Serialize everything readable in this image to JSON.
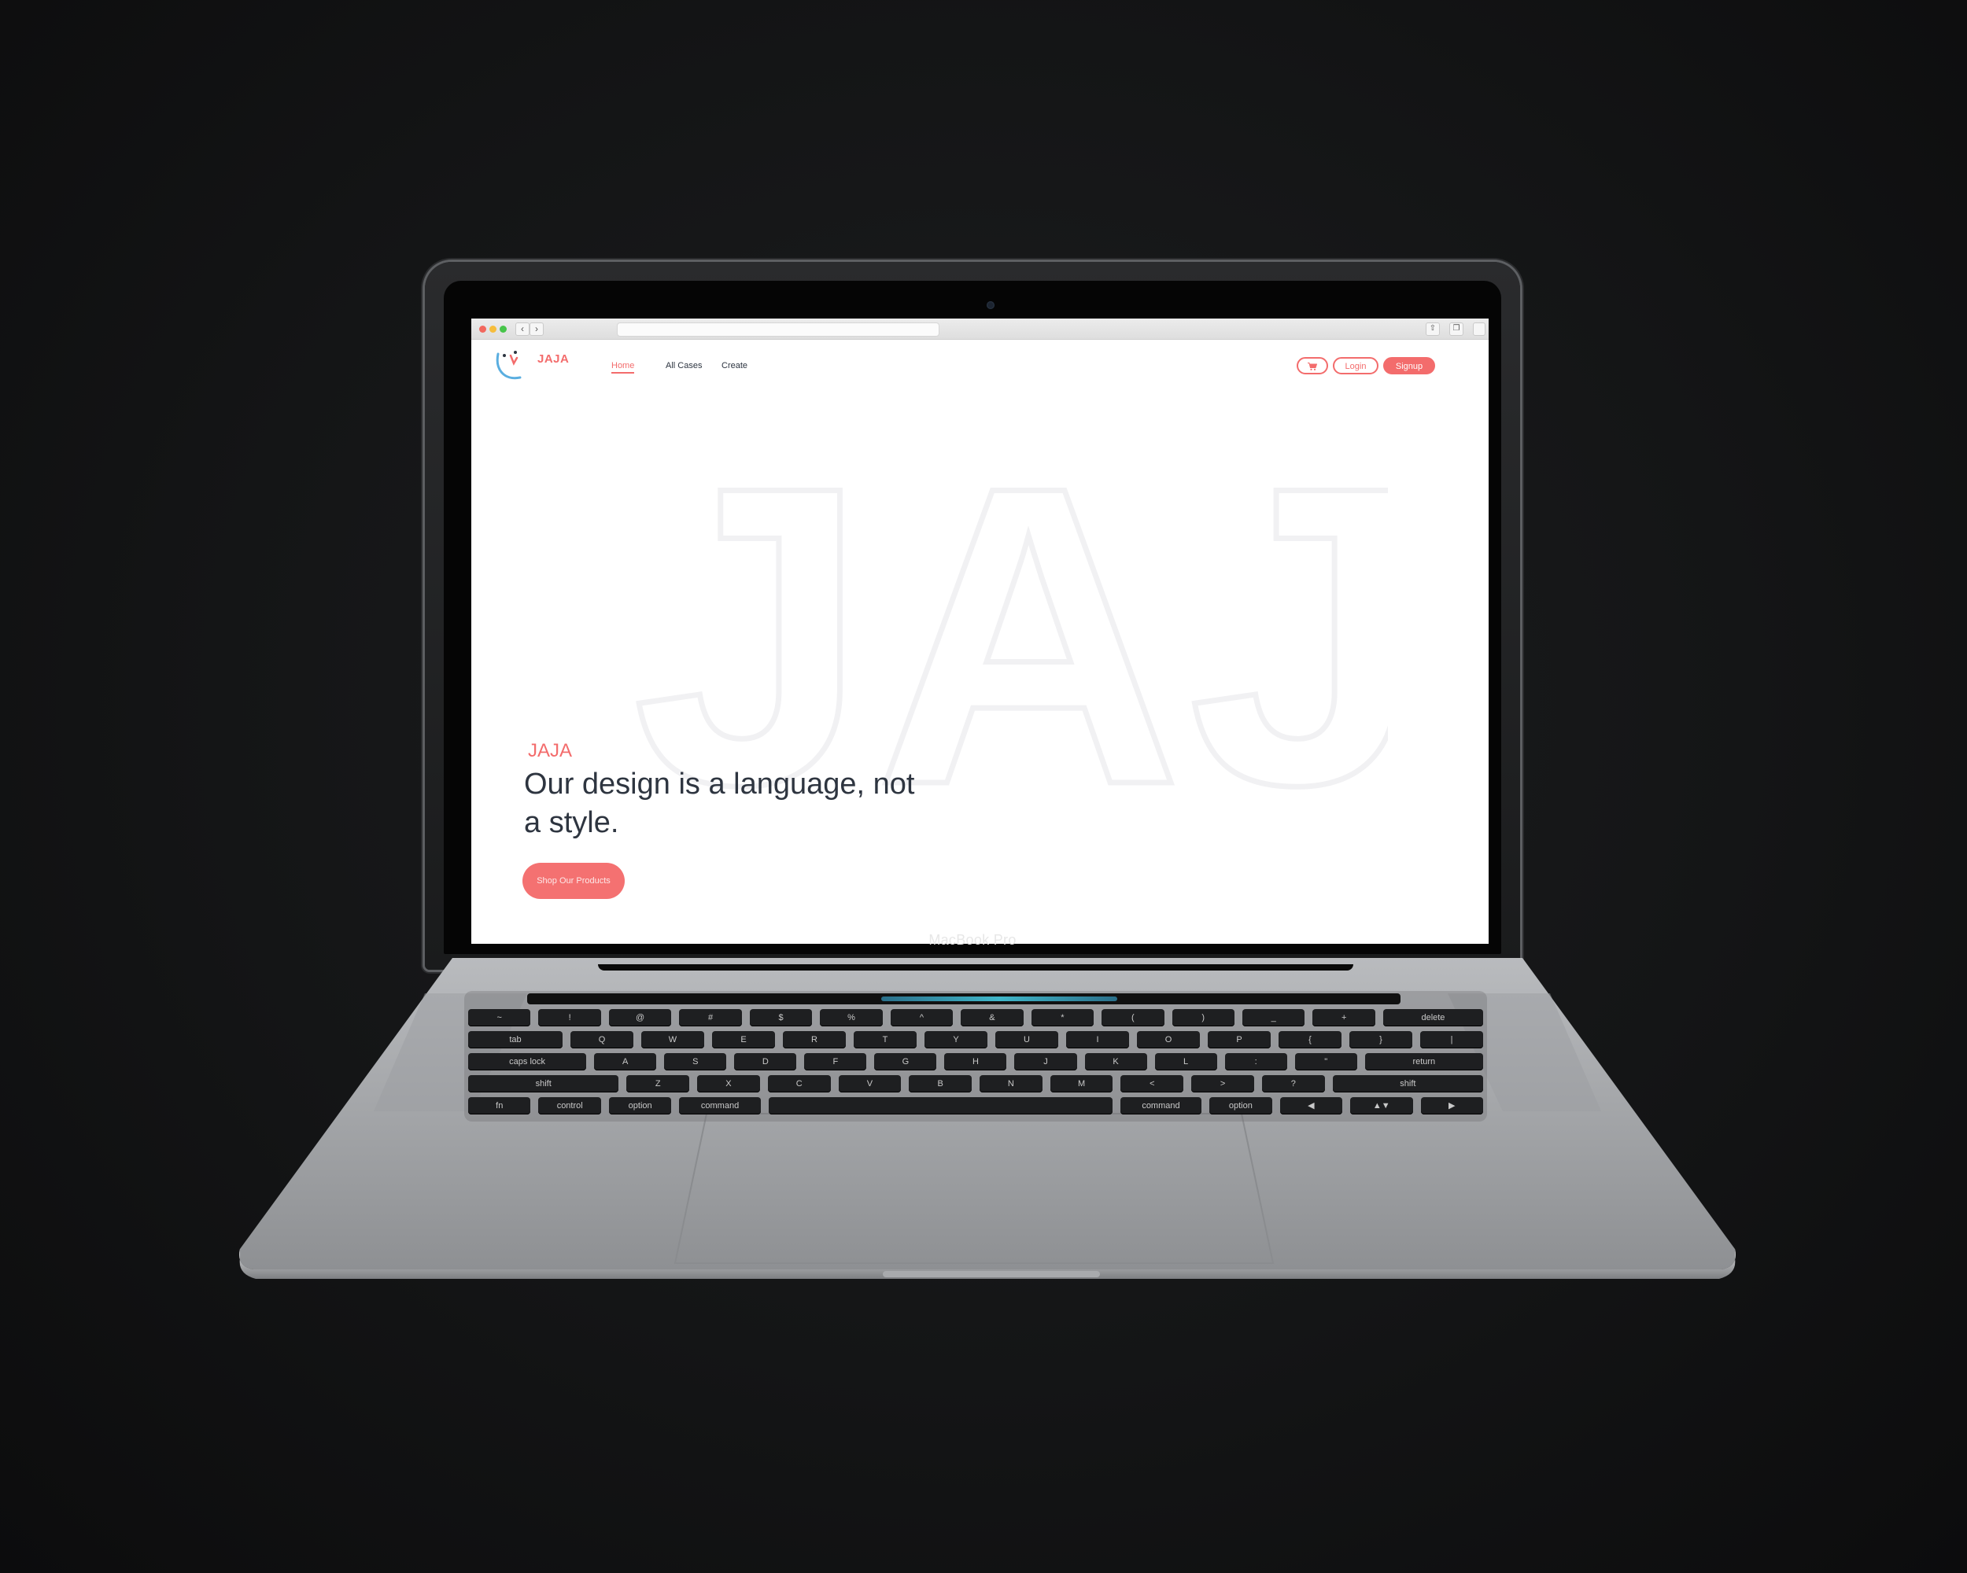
{
  "device": {
    "brand_label": "MacBook Pro"
  },
  "site": {
    "logo_text": "JAJA",
    "nav": [
      {
        "label": "Home",
        "active": true
      },
      {
        "label": "All Cases",
        "active": false
      },
      {
        "label": "Create",
        "active": false
      }
    ],
    "actions": {
      "cart_icon": "cart-icon",
      "login_label": "Login",
      "signup_label": "Signup"
    },
    "hero": {
      "watermark": "JAJA",
      "eyebrow": "JAJA",
      "title": "Our design is a language, not a style.",
      "cta_label": "Shop Our Products"
    }
  },
  "colors": {
    "accent": "#f36c6c",
    "text_dark": "#2e3540",
    "background": "#ffffff"
  },
  "keyboard": {
    "row1": [
      "~",
      "!",
      "@",
      "#",
      "$",
      "%",
      "^",
      "&",
      "*",
      "(",
      ")",
      "_",
      "+",
      "delete"
    ],
    "row2": [
      "tab",
      "Q",
      "W",
      "E",
      "R",
      "T",
      "Y",
      "U",
      "I",
      "O",
      "P",
      "{",
      "}",
      "|"
    ],
    "row3": [
      "caps lock",
      "A",
      "S",
      "D",
      "F",
      "G",
      "H",
      "J",
      "K",
      "L",
      ":",
      "\"",
      "return"
    ],
    "row4": [
      "shift",
      "Z",
      "X",
      "C",
      "V",
      "B",
      "N",
      "M",
      "<",
      ">",
      "?",
      "shift"
    ],
    "row5": [
      "fn",
      "control",
      "option",
      "command",
      "",
      "command",
      "option",
      "◀",
      "▲▼",
      "▶"
    ]
  }
}
